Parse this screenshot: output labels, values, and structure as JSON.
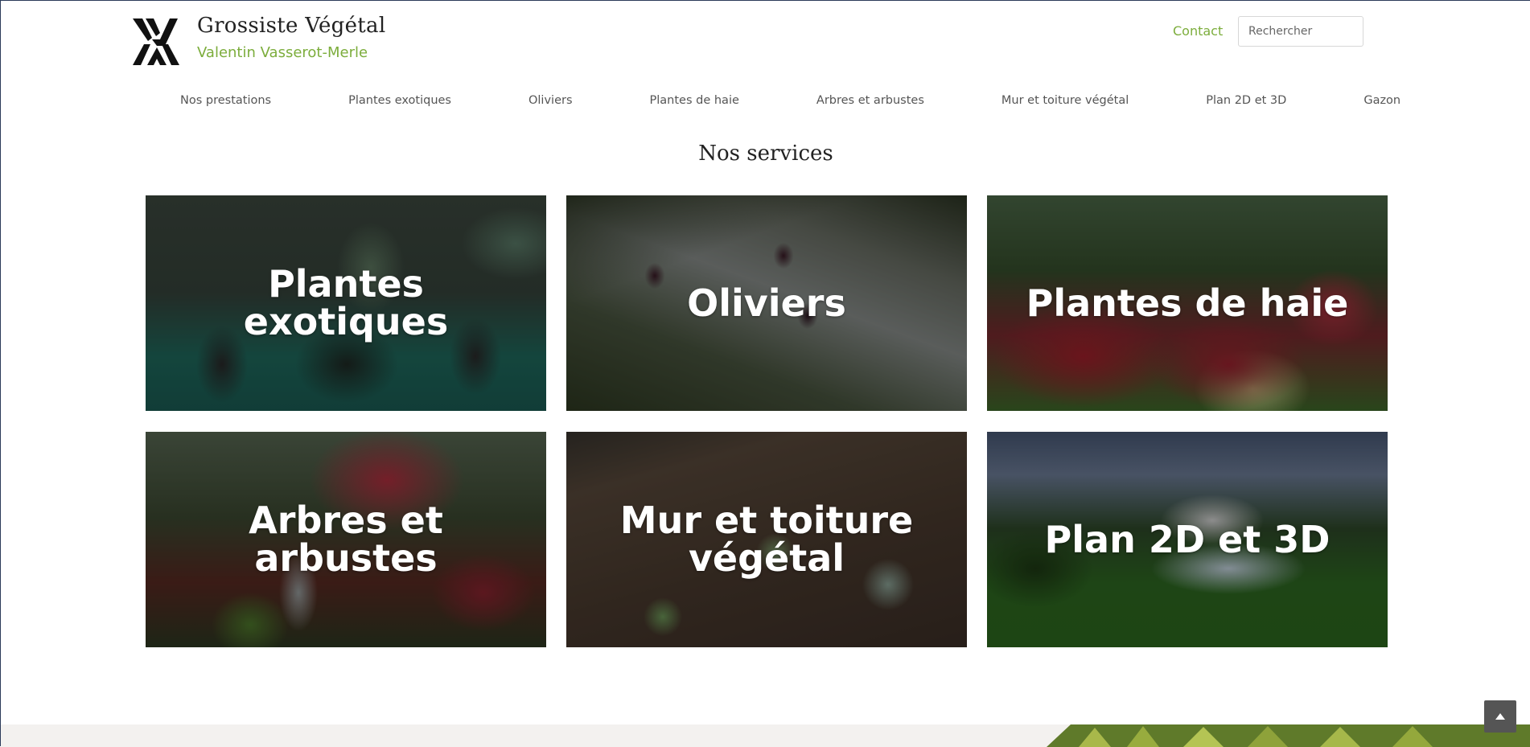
{
  "brand": {
    "logo_letters": "VVM",
    "title": "Grossiste Végétal",
    "subtitle": "Valentin Vasserot-Merle"
  },
  "header": {
    "contact_label": "Contact",
    "search_placeholder": "Rechercher"
  },
  "nav": {
    "items": [
      {
        "label": "Nos prestations"
      },
      {
        "label": "Plantes exotiques"
      },
      {
        "label": "Oliviers"
      },
      {
        "label": "Plantes de haie"
      },
      {
        "label": "Arbres et arbustes"
      },
      {
        "label": "Mur et toiture végétal"
      },
      {
        "label": "Plan 2D et 3D"
      },
      {
        "label": "Gazon"
      }
    ]
  },
  "services": {
    "title": "Nos services",
    "cards": [
      {
        "label": "Plantes exotiques",
        "image": "potted-exotic-plants"
      },
      {
        "label": "Oliviers",
        "image": "olive-branch"
      },
      {
        "label": "Plantes de haie",
        "image": "red-hedge"
      },
      {
        "label": "Arbres et arbustes",
        "image": "japanese-garden"
      },
      {
        "label": "Mur et toiture végétal",
        "image": "green-roof-planting"
      },
      {
        "label": "Plan 2D et 3D",
        "image": "3d-garden-plan"
      }
    ]
  },
  "icons": {
    "scroll_top": "chevron-up-icon"
  },
  "colors": {
    "accent": "#7cad3c",
    "nav_text": "#555555",
    "heading": "#222222",
    "footer_band": "#f3f1ef"
  }
}
